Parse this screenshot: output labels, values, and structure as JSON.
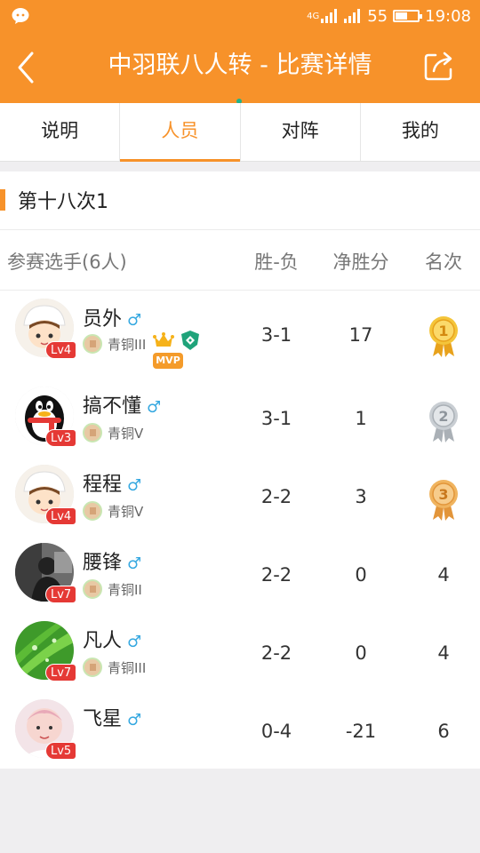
{
  "status_bar": {
    "network": "4G",
    "battery_level": "55",
    "battery_fraction": 0.55,
    "time": "19:08"
  },
  "header": {
    "title": "中羽联八人转 - 比赛详情"
  },
  "tabs": [
    {
      "label": "说明"
    },
    {
      "label": "人员"
    },
    {
      "label": "对阵"
    },
    {
      "label": "我的"
    }
  ],
  "active_tab": "人员",
  "section": {
    "title": "第十八次1"
  },
  "table": {
    "headers": {
      "players": "参赛选手(6人)",
      "win_loss": "胜-负",
      "net_points": "净胜分",
      "rank": "名次"
    },
    "rows": [
      {
        "name": "员外",
        "gender": "♂",
        "level": "Lv4",
        "tier": "青铜III",
        "win_loss": "3-1",
        "net_points": "17",
        "rank": "1",
        "mvp": "MVP",
        "avatar": "cartoon-boy-white-hat"
      },
      {
        "name": "搞不懂",
        "gender": "♂",
        "level": "Lv3",
        "tier": "青铜V",
        "win_loss": "3-1",
        "net_points": "1",
        "rank": "2",
        "avatar": "qq-penguin"
      },
      {
        "name": "程程",
        "gender": "♂",
        "level": "Lv4",
        "tier": "青铜V",
        "win_loss": "2-2",
        "net_points": "3",
        "rank": "3",
        "avatar": "cartoon-boy-white-hat"
      },
      {
        "name": "腰锋",
        "gender": "♂",
        "level": "Lv7",
        "tier": "青铜II",
        "win_loss": "2-2",
        "net_points": "0",
        "rank": "4",
        "avatar": "photo-dark"
      },
      {
        "name": "凡人",
        "gender": "♂",
        "level": "Lv7",
        "tier": "青铜III",
        "win_loss": "2-2",
        "net_points": "0",
        "rank": "4",
        "avatar": "green-leaf"
      },
      {
        "name": "飞星",
        "gender": "♂",
        "level": "Lv5",
        "win_loss": "0-4",
        "net_points": "-21",
        "rank": "6",
        "avatar": "baby-photo"
      }
    ]
  },
  "colors": {
    "accent": "#f7922a",
    "gold": "#f4c53a",
    "silver": "#c9ced3",
    "bronze": "#f0b45f",
    "level_badge": "#e53935"
  }
}
